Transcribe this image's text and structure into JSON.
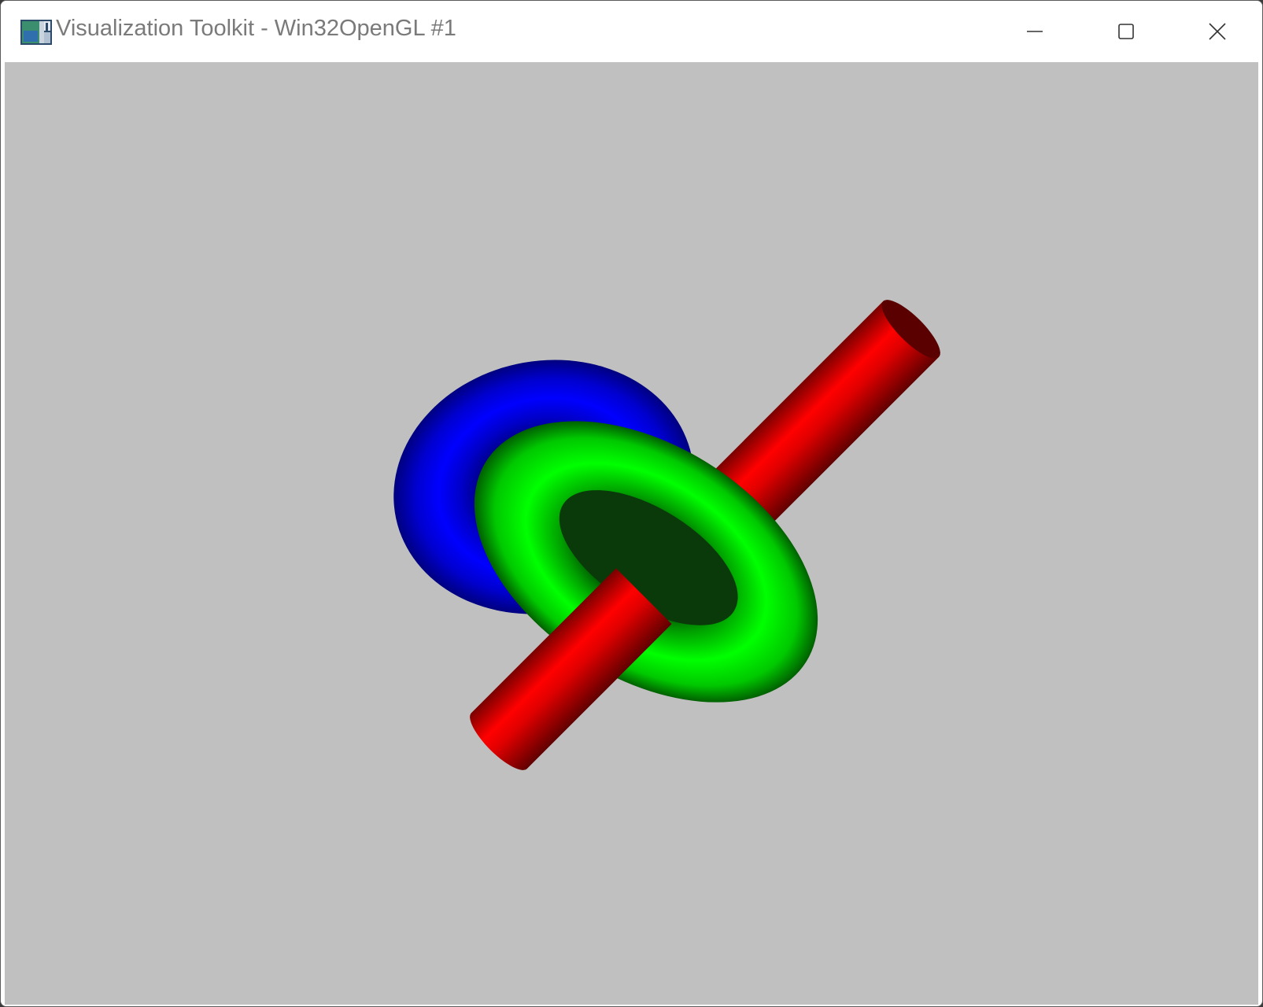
{
  "window": {
    "title": "Visualization Toolkit - Win32OpenGL #1",
    "background_color": "#c0c0c0",
    "controls": {
      "minimize_icon": "minimize-icon",
      "maximize_icon": "maximize-icon",
      "close_icon": "close-icon"
    }
  },
  "scene": {
    "objects": [
      {
        "name": "blue-torus",
        "color": "#0000ff"
      },
      {
        "name": "green-torus",
        "color": "#00e800"
      },
      {
        "name": "red-cylinder",
        "color": "#e00000"
      }
    ]
  }
}
